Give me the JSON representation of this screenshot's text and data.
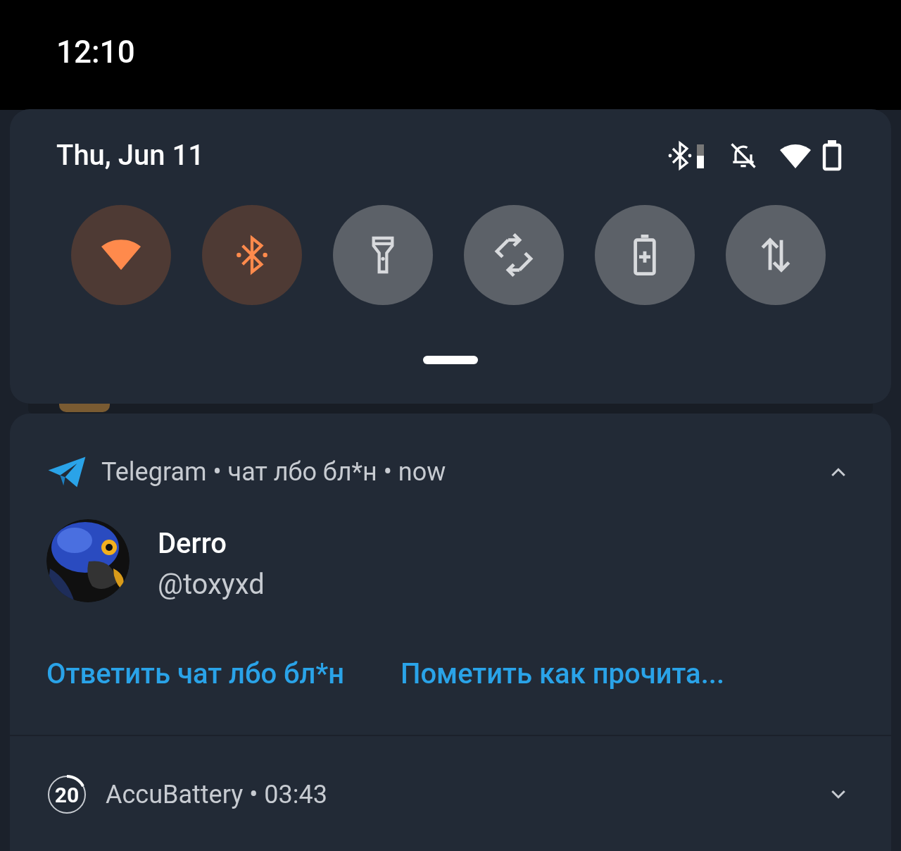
{
  "status_bar": {
    "time": "12:10"
  },
  "quick_settings": {
    "date": "Thu, Jun 11",
    "tiles": [
      {
        "kind": "wifi",
        "on": true
      },
      {
        "kind": "bluetooth",
        "on": true
      },
      {
        "kind": "flashlight",
        "on": false
      },
      {
        "kind": "rotate",
        "on": false
      },
      {
        "kind": "battery_saver",
        "on": false
      },
      {
        "kind": "data",
        "on": false
      }
    ]
  },
  "notifications": [
    {
      "header": "Telegram • чат лбо бл*н • now",
      "expanded": true,
      "sender": "Derro",
      "message": "@toxyxd",
      "actions": [
        "Ответить чат лбо бл*н",
        "Пометить как прочита..."
      ]
    },
    {
      "header": "AccuBattery • 03:43",
      "badge": "20",
      "expanded": false
    }
  ]
}
